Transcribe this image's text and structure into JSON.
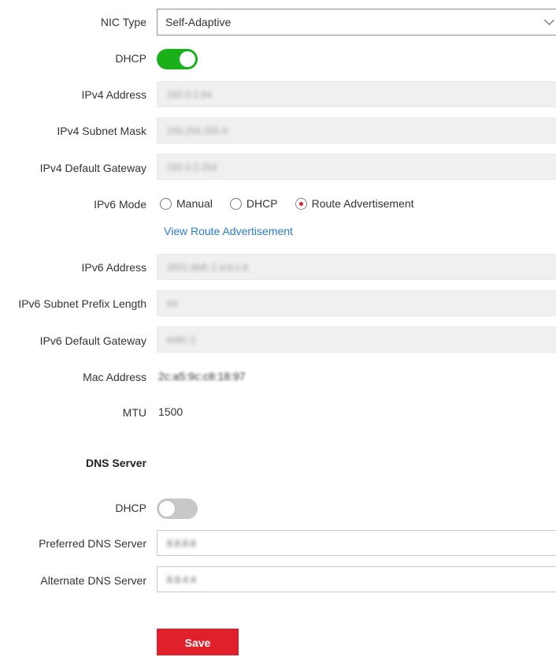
{
  "nic_type": {
    "label": "NIC Type",
    "value": "Self-Adaptive"
  },
  "dhcp": {
    "label": "DHCP",
    "enabled": true
  },
  "ipv4_address": {
    "label": "IPv4 Address",
    "value": "192.0.2.64"
  },
  "ipv4_subnet_mask": {
    "label": "IPv4 Subnet Mask",
    "value": "255.255.255.0"
  },
  "ipv4_default_gateway": {
    "label": "IPv4 Default Gateway",
    "value": "192.0.2.254"
  },
  "ipv6_mode": {
    "label": "IPv6 Mode",
    "options": [
      "Manual",
      "DHCP",
      "Route Advertisement"
    ],
    "selected": "Route Advertisement",
    "view_link": "View Route Advertisement"
  },
  "ipv6_address": {
    "label": "IPv6 Address",
    "value": "2001:db8::1:a:b:c:d"
  },
  "ipv6_prefix_length": {
    "label": "IPv6 Subnet Prefix Length",
    "value": "64"
  },
  "ipv6_default_gateway": {
    "label": "IPv6 Default Gateway",
    "value": "fe80::1"
  },
  "mac_address": {
    "label": "Mac Address",
    "value": "2c:a5:9c:c8:18:97"
  },
  "mtu": {
    "label": "MTU",
    "value": "1500"
  },
  "dns": {
    "section_title": "DNS Server",
    "dhcp_label": "DHCP",
    "dhcp_enabled": false,
    "preferred_label": "Preferred DNS Server",
    "preferred_value": "8.8.8.8",
    "alternate_label": "Alternate DNS Server",
    "alternate_value": "8.8.4.4"
  },
  "save_label": "Save",
  "colors": {
    "accent_green": "#1ab01a",
    "save_red": "#e0202a",
    "link_blue": "#2a7bd5"
  }
}
